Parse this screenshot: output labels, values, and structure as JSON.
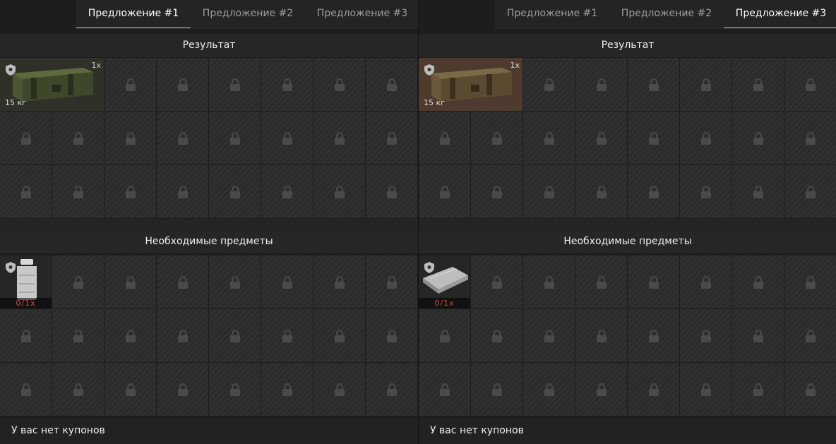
{
  "left": {
    "tabs": [
      "Предложение #1",
      "Предложение #2",
      "Предложение #3"
    ],
    "active_tab": 0,
    "result_header": "Результат",
    "result_item": {
      "name": "ammo-crate",
      "quantity": "1x",
      "weight": "15 кг"
    },
    "required_header": "Необходимые предметы",
    "required_item": {
      "name": "canister",
      "need": "0/1x"
    },
    "footer": "У вас нет купонов"
  },
  "right": {
    "tabs": [
      "Предложение #1",
      "Предложение #2",
      "Предложение #3"
    ],
    "active_tab": 2,
    "result_header": "Результат",
    "result_item": {
      "name": "ammo-crate",
      "quantity": "1x",
      "weight": "15 кг"
    },
    "required_header": "Необходимые предметы",
    "required_item": {
      "name": "metal-sheets",
      "need": "0/1x"
    },
    "footer": "У вас нет купонов"
  },
  "colors": {
    "need_text": "#d44b3a",
    "active_tab_underline": "#cfcfcf",
    "result_left_bg": "#2f3129",
    "result_right_bg": "#4e3b2e"
  }
}
